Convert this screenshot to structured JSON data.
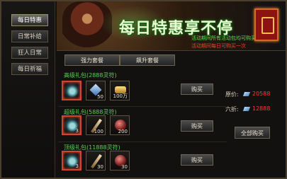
{
  "sidebar": {
    "items": [
      {
        "label": "每日特惠",
        "active": true
      },
      {
        "label": "日常补给",
        "active": false
      },
      {
        "label": "狂人日常",
        "active": false
      },
      {
        "label": "每日祈福",
        "active": false
      }
    ]
  },
  "banner": {
    "title": "每日特惠享不停",
    "note1": "活动期间所有活动包均可购买",
    "note2": "活动期间每日可购买一次"
  },
  "tabs": [
    {
      "label": "强力套餐"
    },
    {
      "label": "飙升套餐"
    }
  ],
  "packages": [
    {
      "title": "高级礼包(2888灵符)",
      "buy_label": "购买",
      "items": [
        {
          "icon": "scroll-icon",
          "qty": ""
        },
        {
          "icon": "crystal-icon",
          "qty": "50"
        },
        {
          "icon": "gold-icon",
          "qty": "100万"
        }
      ]
    },
    {
      "title": "超级礼包(5888灵符)",
      "buy_label": "购买",
      "items": [
        {
          "icon": "scroll-icon",
          "qty": "3"
        },
        {
          "icon": "sword-icon",
          "qty": "100"
        },
        {
          "icon": "orb-icon",
          "qty": "200"
        }
      ]
    },
    {
      "title": "顶级礼包(11888灵符)",
      "buy_label": "购买",
      "items": [
        {
          "icon": "scroll-icon",
          "qty": "3"
        },
        {
          "icon": "sword-icon",
          "qty": "30"
        },
        {
          "icon": "orb-icon",
          "qty": "30"
        }
      ]
    }
  ],
  "pricing": {
    "original_label": "原价:",
    "original_value": "20588",
    "discount_label": "六折:",
    "discount_value": "12888",
    "buy_all_label": "全部购买"
  },
  "colors": {
    "accent_green": "#58d24e",
    "price_red": "#ff3b2a",
    "border_gold": "#4a3f2c"
  }
}
